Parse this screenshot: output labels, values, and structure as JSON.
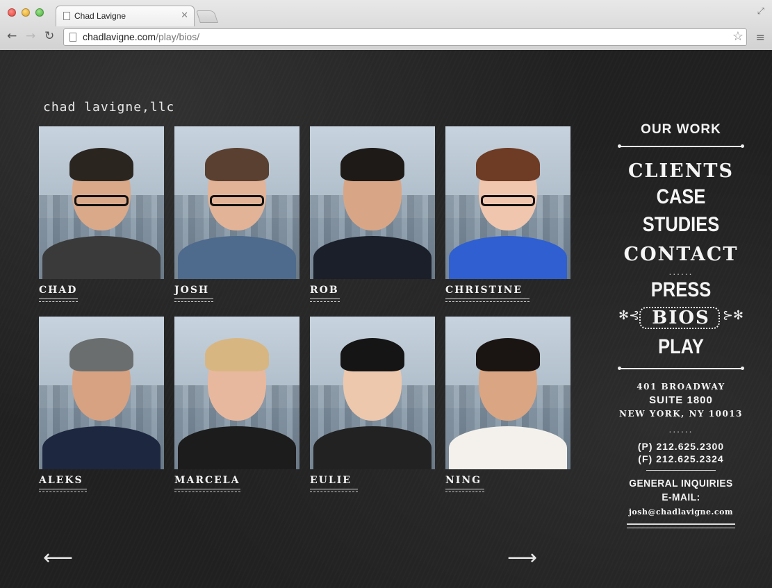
{
  "browser": {
    "tab_title": "Chad Lavigne",
    "url_host": "chadlavigne.com",
    "url_path": "/play/bios/"
  },
  "site": {
    "logo": "chad lavigne,llc"
  },
  "people": [
    {
      "name": "CHAD",
      "skin": "#d9a98a",
      "hair": "#2b2520",
      "shirt": "#3a3a3a",
      "glasses": true
    },
    {
      "name": "JOSH",
      "skin": "#e2b397",
      "hair": "#5a4030",
      "shirt": "#4e6a8c",
      "glasses": true
    },
    {
      "name": "ROB",
      "skin": "#d8a686",
      "hair": "#1e1a18",
      "shirt": "#1a1f2a",
      "glasses": false
    },
    {
      "name": "CHRISTINE",
      "skin": "#f0c6ae",
      "hair": "#6e3b24",
      "shirt": "#2f5fd0",
      "glasses": true
    },
    {
      "name": "ALEKS",
      "skin": "#d7a282",
      "hair": "#6b6e6e",
      "shirt": "#1d2740",
      "glasses": false
    },
    {
      "name": "MARCELA",
      "skin": "#e8b89e",
      "hair": "#d8b682",
      "shirt": "#1c1c1c",
      "glasses": false
    },
    {
      "name": "EULIE",
      "skin": "#edc8ad",
      "hair": "#151515",
      "shirt": "#222222",
      "glasses": false
    },
    {
      "name": "NING",
      "skin": "#d9a583",
      "hair": "#1a1512",
      "shirt": "#f4f1ec",
      "glasses": false
    }
  ],
  "nav": {
    "our_work": "OUR WORK",
    "clients": "CLIENTS",
    "case_studies": "CASE STUDIES",
    "contact": "CONTACT",
    "press": "PRESS",
    "bios": "BIOS",
    "play": "PLAY",
    "dots": "......"
  },
  "contact": {
    "addr1": "401 BROADWAY",
    "addr2": "SUITE 1800",
    "addr3": "NEW YORK, NY 10013",
    "phone": "(P) 212.625.2300",
    "fax": "(F) 212.625.2324",
    "inquiries1": "GENERAL INQUIRIES",
    "inquiries2": "E-MAIL:",
    "email": "josh@chadlavigne.com"
  },
  "icons": {
    "prev": "prev-arrow-icon",
    "next": "next-arrow-icon"
  }
}
